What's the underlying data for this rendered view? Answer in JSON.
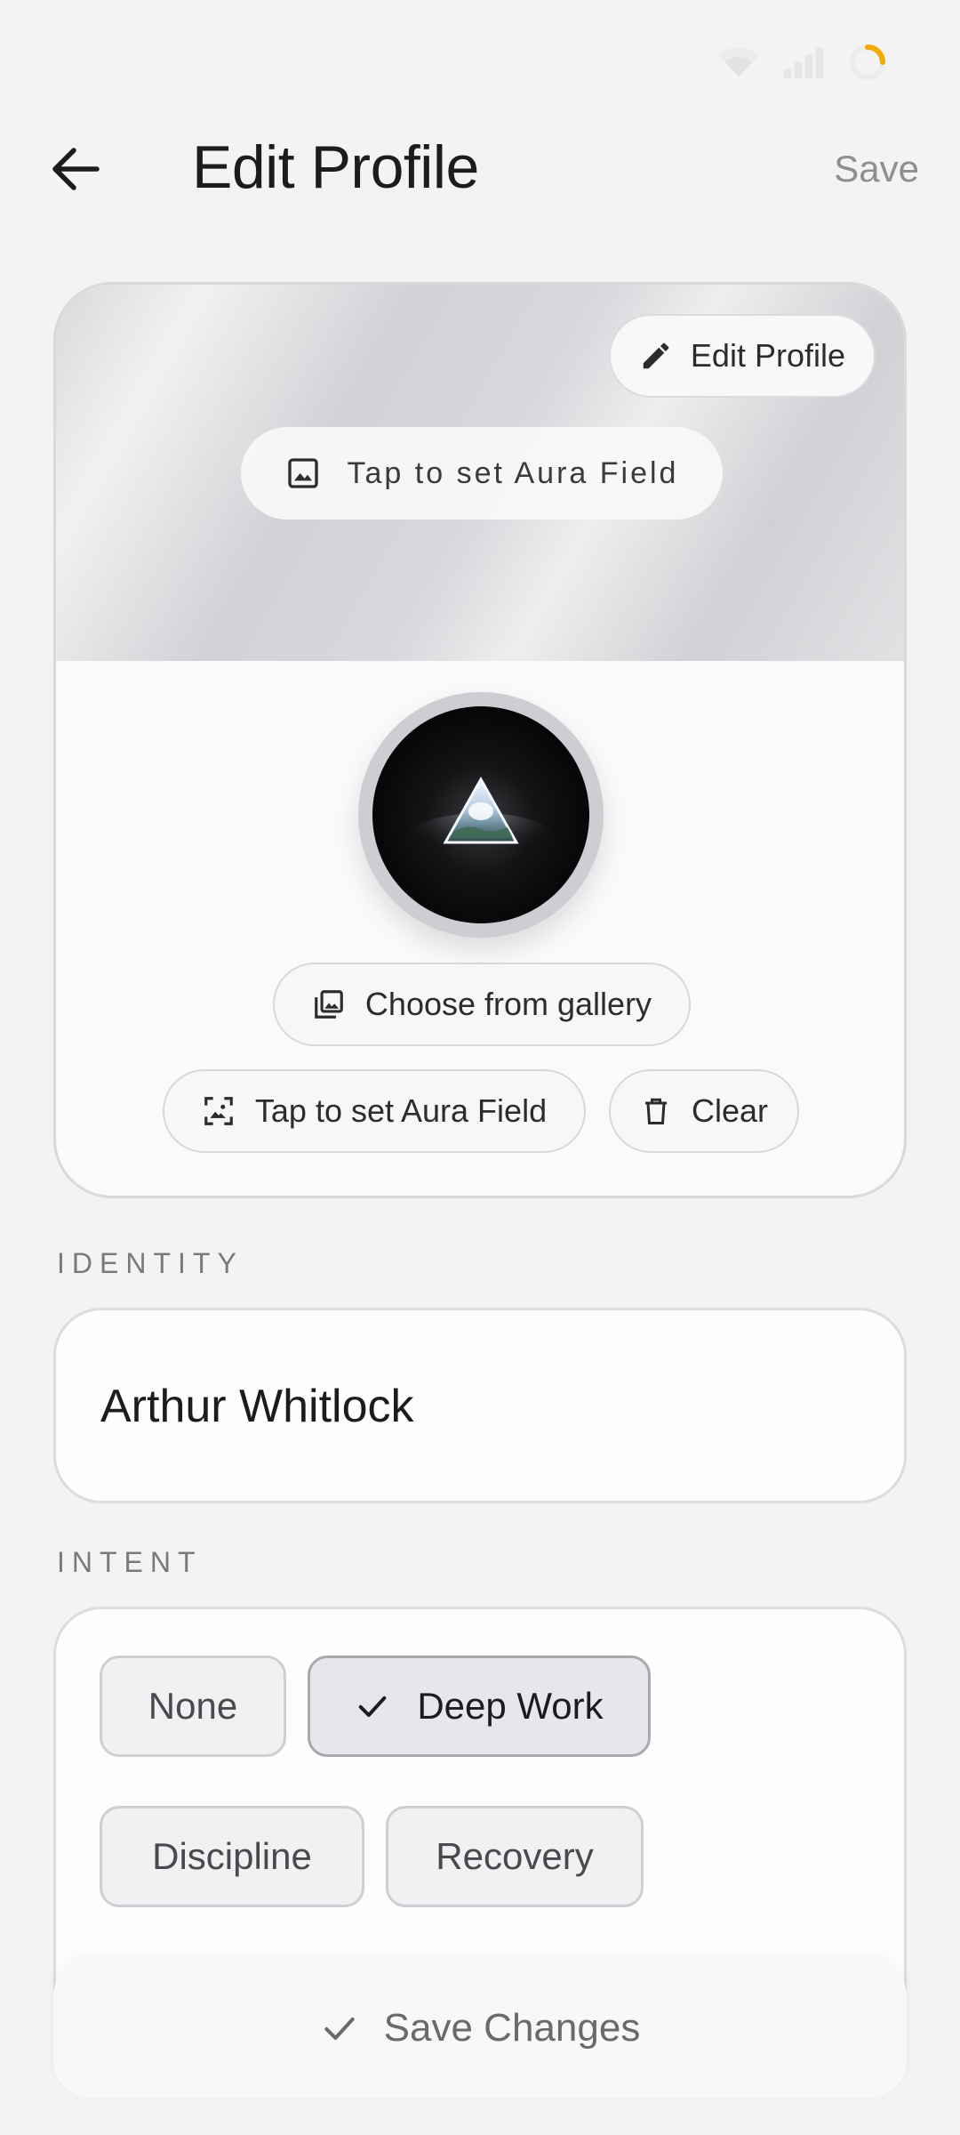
{
  "header": {
    "title": "Edit Profile",
    "save_label": "Save"
  },
  "profile_card": {
    "edit_profile_label": "Edit Profile",
    "banner_aura_label": "Tap to set Aura Field",
    "gallery_label": "Choose from gallery",
    "aura_label": "Tap to set Aura Field",
    "clear_label": "Clear"
  },
  "identity": {
    "section_label": "IDENTITY",
    "name": "Arthur Whitlock"
  },
  "intent": {
    "section_label": "INTENT",
    "options": [
      {
        "label": "None",
        "selected": false
      },
      {
        "label": "Deep Work",
        "selected": true
      },
      {
        "label": "Discipline",
        "selected": false
      },
      {
        "label": "Recovery",
        "selected": false
      }
    ]
  },
  "footer": {
    "save_changes_label": "Save Changes"
  },
  "colors": {
    "background": "#f3f3f3",
    "accent_loader": "#f2a900",
    "selected_chip": "#e6e7eb"
  }
}
